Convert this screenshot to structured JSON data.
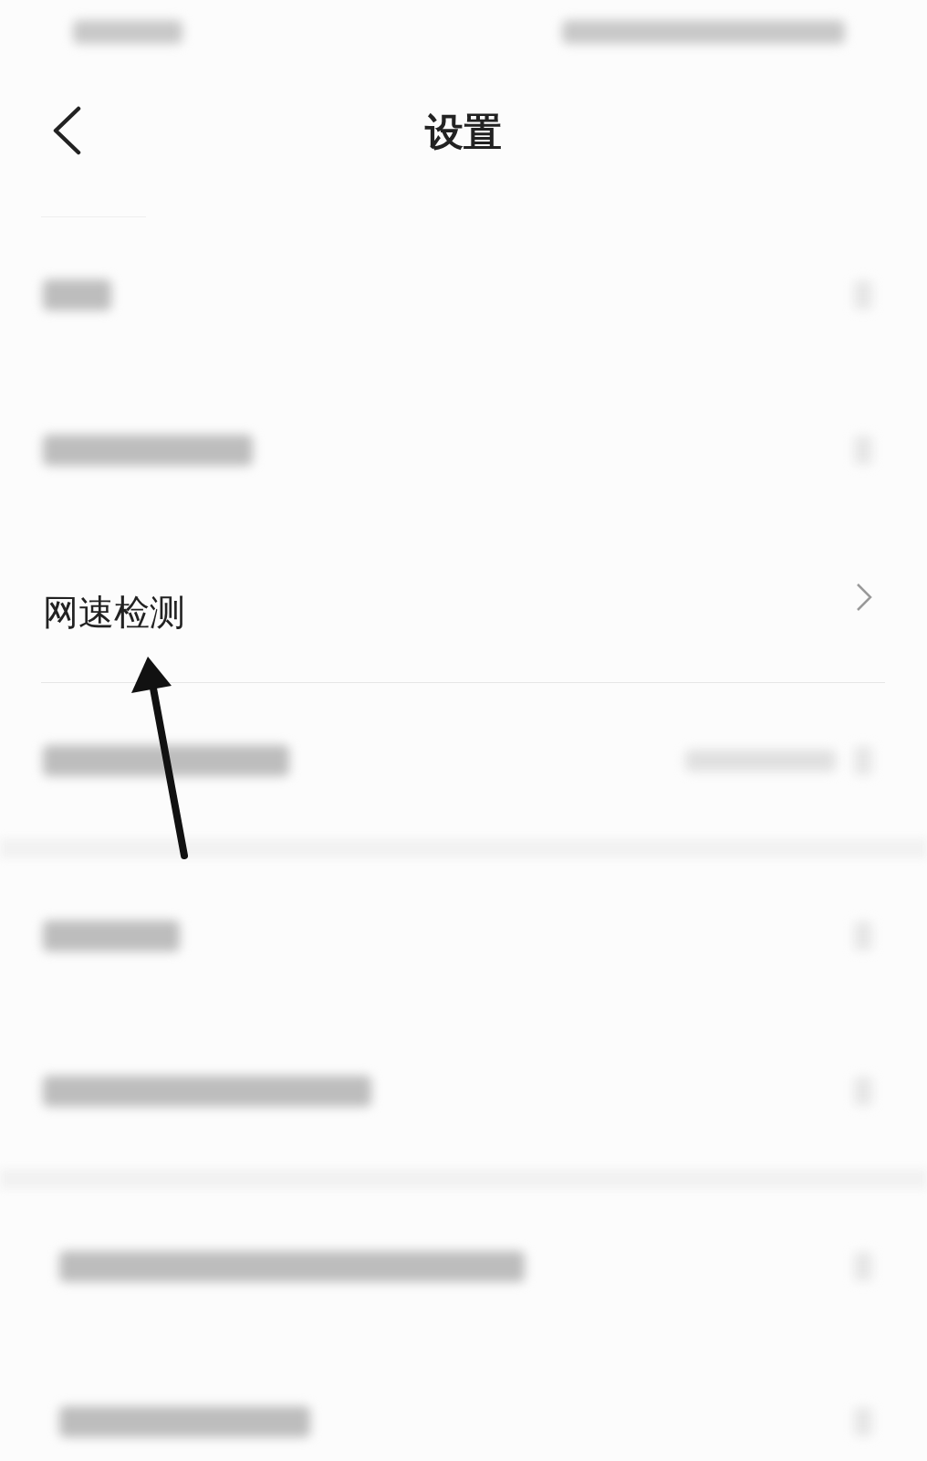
{
  "header": {
    "title": "设置"
  },
  "sections": [
    {
      "rows": [
        {
          "kind": "blurred"
        },
        {
          "kind": "blurred"
        },
        {
          "kind": "item",
          "label": "网速检测"
        },
        {
          "kind": "blurred_value"
        }
      ]
    },
    {
      "rows": [
        {
          "kind": "blurred"
        },
        {
          "kind": "blurred"
        }
      ]
    },
    {
      "rows": [
        {
          "kind": "blurred"
        },
        {
          "kind": "blurred"
        }
      ]
    }
  ],
  "annotation": {
    "kind": "arrow"
  }
}
